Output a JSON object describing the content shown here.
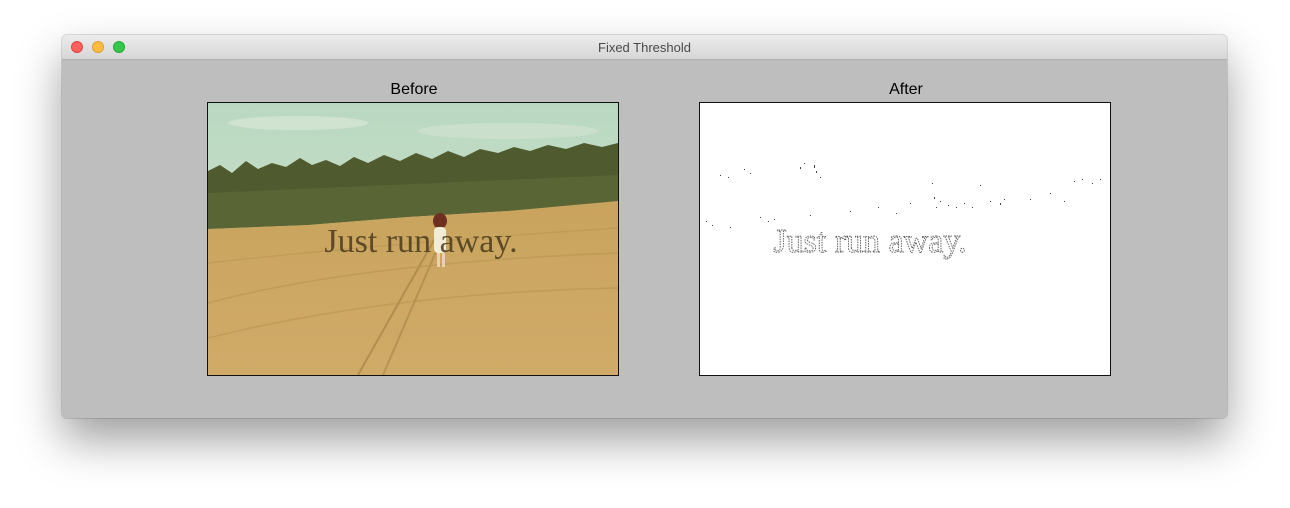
{
  "window": {
    "title": "Fixed Threshold"
  },
  "panels": {
    "before": {
      "label": "Before",
      "image_text": "Just run away."
    },
    "after": {
      "label": "After",
      "image_text": "Just run away."
    }
  }
}
